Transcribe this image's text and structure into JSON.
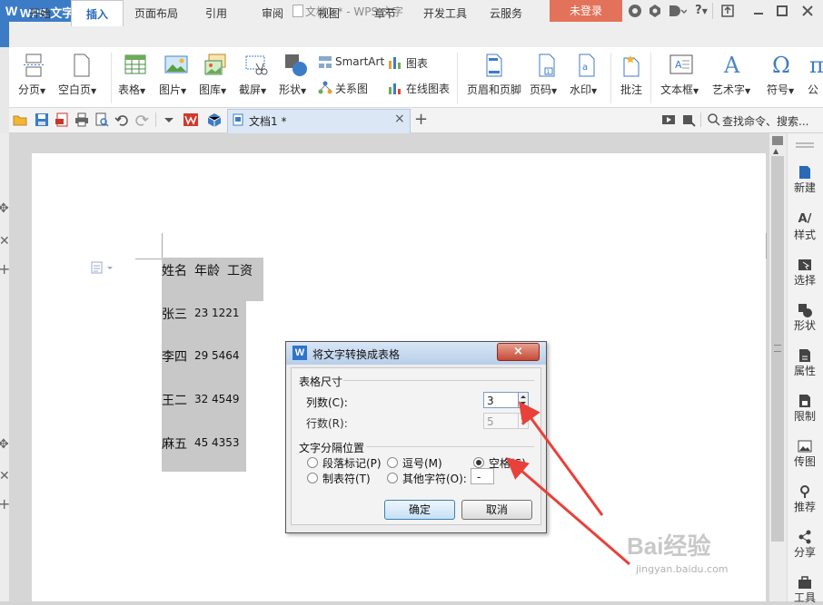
{
  "app": {
    "logo": "W",
    "name": "WPS 文字",
    "doc_title": "文档1 * - WPS 文字",
    "login_label": "未登录"
  },
  "titlebar_icons": [
    "skin-icon",
    "settings-icon",
    "theme-icon",
    "help-icon",
    "restore-icon",
    "minimize-icon",
    "maximize-icon",
    "close-icon"
  ],
  "titlebar_help": "?",
  "tabs": [
    "开始",
    "插入",
    "页面布局",
    "引用",
    "审阅",
    "视图",
    "章节",
    "开发工具",
    "云服务"
  ],
  "active_tab": "插入",
  "ribbon": {
    "page_break": "分页",
    "blank_page": "空白页",
    "table": "表格",
    "picture": "图片",
    "gallery": "图库",
    "screenshot": "截屏",
    "shape": "形状",
    "smartart": "SmartArt",
    "chart": "图表",
    "relation": "关系图",
    "online_chart": "在线图表",
    "header_footer": "页眉和页脚",
    "page_number": "页码",
    "watermark": "水印",
    "comment": "批注",
    "textbox": "文本框",
    "wordart": "艺术字",
    "symbol": "符号",
    "formula_partial": "公"
  },
  "doc_tab": {
    "label": "文档1 *",
    "close": "×",
    "add": "+"
  },
  "search": {
    "label": "查找命令、搜索..."
  },
  "document": {
    "rows": [
      {
        "name": "姓名",
        "age": "年龄",
        "salary": "工资"
      },
      {
        "name": "张三",
        "age": "23",
        "salary": "1221"
      },
      {
        "name": "李四",
        "age": "29",
        "salary": "5464"
      },
      {
        "name": "王二",
        "age": "32",
        "salary": "4549"
      },
      {
        "name": "麻五",
        "age": "45",
        "salary": "4353"
      }
    ]
  },
  "sidebar": [
    "新建",
    "样式",
    "选择",
    "形状",
    "属性",
    "限制",
    "传图",
    "推荐",
    "分享",
    "工具"
  ],
  "dialog": {
    "title": "将文字转换成表格",
    "close": "×",
    "size_group": "表格尺寸",
    "columns_label": "列数(C):",
    "columns_value": "3",
    "rows_label": "行数(R):",
    "rows_value": "5",
    "separator_group": "文字分隔位置",
    "opt_paragraph": "段落标记(P)",
    "opt_comma": "逗号(M)",
    "opt_space": "空格(S)",
    "opt_tab": "制表符(T)",
    "opt_other": "其他字符(O):",
    "other_value": "-",
    "selected": "opt_space",
    "ok": "确定",
    "cancel": "取消"
  },
  "watermark": {
    "text": "Bai经验",
    "url": "jingyan.baidu.com"
  },
  "colors": {
    "accent": "#3c7cc6",
    "login": "#e2735a",
    "arrow": "#e8413a",
    "selection": "#c8c8c8"
  }
}
